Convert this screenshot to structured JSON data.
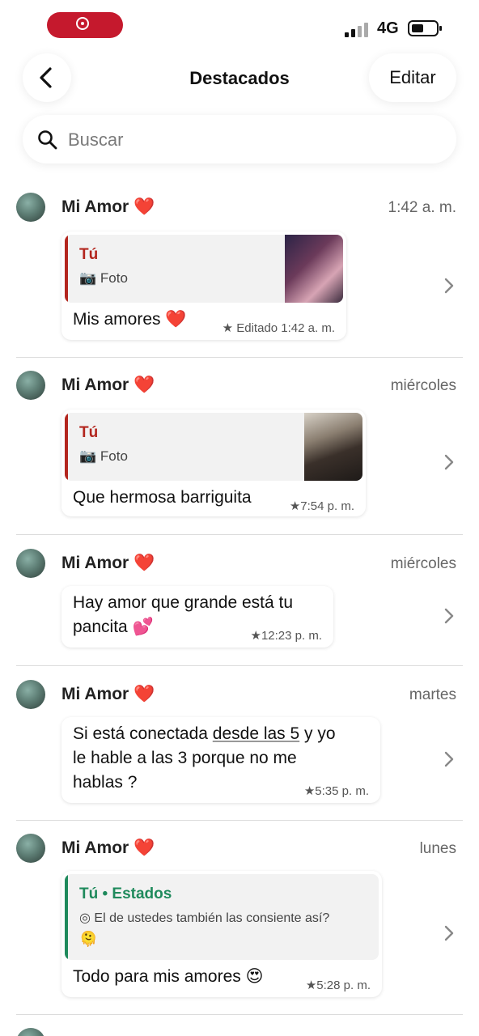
{
  "status": {
    "network": "4G"
  },
  "header": {
    "title": "Destacados",
    "edit_label": "Editar"
  },
  "search": {
    "placeholder": "Buscar"
  },
  "items": [
    {
      "name": "Mi Amor",
      "time": "1:42 a. m.",
      "quote": {
        "name": "Tú",
        "subtitle": "Foto"
      },
      "message": "Mis amores",
      "emoji": "❤️",
      "meta": "★ Editado 1:42 a. m."
    },
    {
      "name": "Mi Amor",
      "time": "miércoles",
      "quote": {
        "name": "Tú",
        "subtitle": "Foto"
      },
      "message": "Que hermosa barriguita",
      "meta": "★7:54 p. m."
    },
    {
      "name": "Mi Amor",
      "time": "miércoles",
      "message_line1": "Hay amor que grande está tu",
      "message_line2": "pancita",
      "emoji": "💕",
      "meta": "★12:23 p. m."
    },
    {
      "name": "Mi Amor",
      "time": "martes",
      "message_pre": "Si está conectada ",
      "message_link": "desde las 5",
      "message_post": " y yo",
      "message_line2": "le hable a las 3 porque no me",
      "message_line3": "hablas ?",
      "meta": "★5:35 p. m."
    },
    {
      "name": "Mi Amor",
      "time": "lunes",
      "quote": {
        "name": "Tú • Estados",
        "subtitle": "El de ustedes también las consiente así?",
        "emoji": "🫠"
      },
      "message": "Todo para mis amores",
      "emoji": "😍",
      "meta": "★5:28 p. m."
    }
  ],
  "colors": {
    "accent_red": "#c5192d",
    "heart": "#d0021b",
    "status_green": "#1f8a5c"
  }
}
